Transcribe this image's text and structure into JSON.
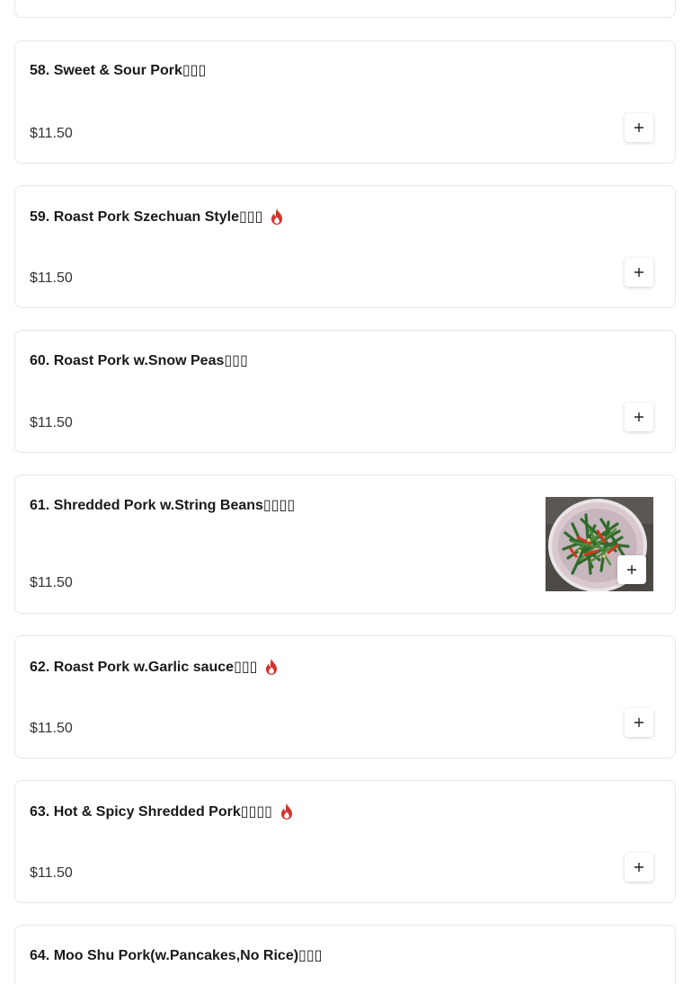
{
  "items": [
    {
      "title": "58. Sweet & Sour Pork▯▯▯",
      "price": "$11.50",
      "spicy": false,
      "has_photo": false
    },
    {
      "title": "59. Roast Pork Szechuan Style▯▯▯",
      "price": "$11.50",
      "spicy": true,
      "has_photo": false
    },
    {
      "title": "60. Roast Pork w.Snow Peas▯▯▯",
      "price": "$11.50",
      "spicy": false,
      "has_photo": false
    },
    {
      "title": "61. Shredded Pork w.String Beans▯▯▯▯",
      "price": "$11.50",
      "spicy": false,
      "has_photo": true
    },
    {
      "title": "62. Roast Pork w.Garlic sauce▯▯▯",
      "price": "$11.50",
      "spicy": true,
      "has_photo": false
    },
    {
      "title": "63. Hot & Spicy Shredded Pork▯▯▯▯",
      "price": "$11.50",
      "spicy": true,
      "has_photo": false
    },
    {
      "title": "64. Moo Shu Pork(w.Pancakes,No Rice)▯▯▯",
      "price": "",
      "spicy": false,
      "has_photo": false
    }
  ],
  "icons": {
    "add": "plus-icon",
    "spicy": "fire-icon"
  },
  "colors": {
    "spicy": "#d0342c",
    "border": "#e8e8e8"
  }
}
